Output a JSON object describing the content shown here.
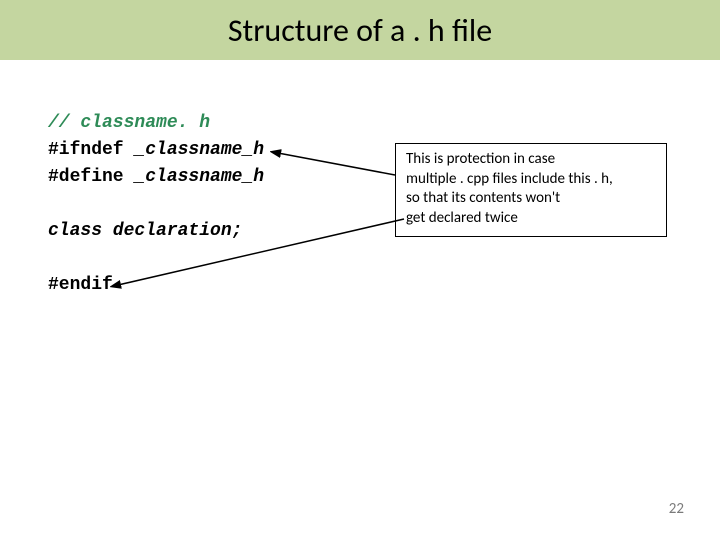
{
  "title": "Structure of a . h file",
  "code": {
    "line1": "// classname. h",
    "line2_pre": "#ifndef ",
    "line2_guard": "_classname_h",
    "line3_pre": "#define ",
    "line3_guard": "_classname_h",
    "class_decl": "class declaration;",
    "endif": "#endif"
  },
  "callout": {
    "l1": "This is protection in case",
    "l2": "multiple . cpp files include this . h,",
    "l3": "so that its contents won't",
    "l4": "get declared twice"
  },
  "page_number": "22"
}
